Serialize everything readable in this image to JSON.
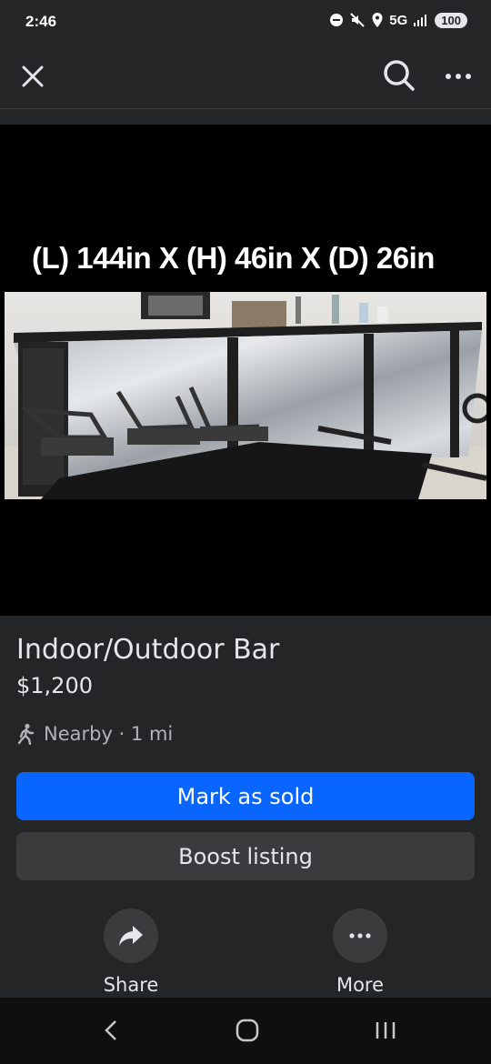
{
  "status_bar": {
    "time": "2:46",
    "network": "5G",
    "battery": "100"
  },
  "top_bar": {
    "close_icon": "close-icon",
    "search_icon": "search-icon",
    "more_icon": "more-horizontal-icon"
  },
  "listing_image": {
    "caption": "(L) 144in X (H) 46in X (D) 26in",
    "description_icon": "bar-photo"
  },
  "listing": {
    "title": "Indoor/Outdoor Bar",
    "price": "$1,200",
    "location": "Nearby · 1 mi",
    "location_icon": "walking-person-icon"
  },
  "buttons": {
    "mark_sold": "Mark as sold",
    "boost": "Boost listing"
  },
  "actions": {
    "share_label": "Share",
    "share_icon": "share-arrow-icon",
    "more_label": "More",
    "more_icon": "more-horizontal-icon"
  },
  "colors": {
    "primary": "#0866ff",
    "background": "#242526",
    "surface": "#3a3b3c"
  }
}
